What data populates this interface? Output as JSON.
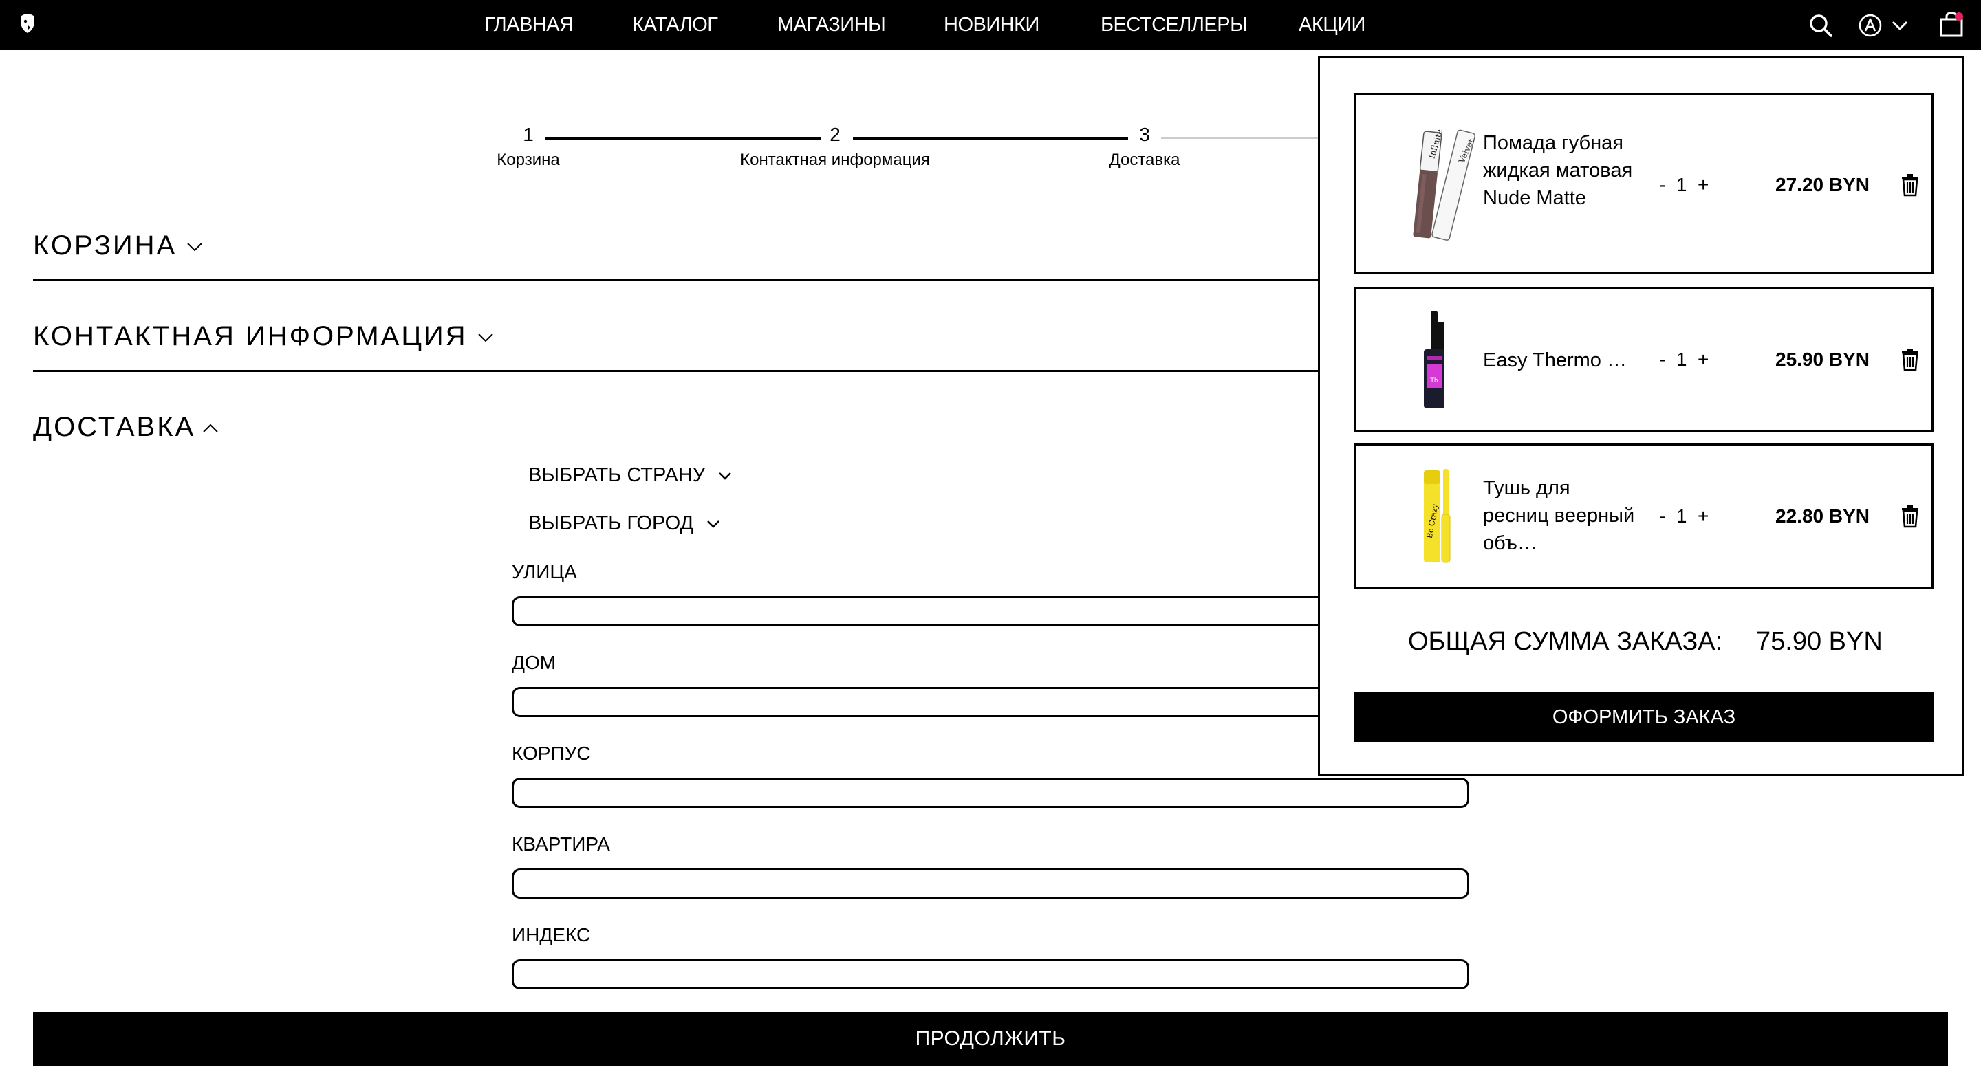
{
  "nav": {
    "items": [
      {
        "label": "ГЛАВНАЯ"
      },
      {
        "label": "КАТАЛОГ"
      },
      {
        "label": "МАГАЗИНЫ"
      },
      {
        "label": "НОВИНКИ"
      },
      {
        "label": "БЕСТСЕЛЛЕРЫ"
      },
      {
        "label": "АКЦИИ"
      }
    ],
    "icons": [
      "search-icon",
      "account-icon",
      "chevron-down-icon",
      "shopping-bag-icon"
    ]
  },
  "stepper": {
    "steps": [
      {
        "number": "1",
        "label": "Корзина"
      },
      {
        "number": "2",
        "label": "Контактная информация"
      },
      {
        "number": "3",
        "label": "Доставка"
      }
    ]
  },
  "sections": {
    "cart": "КОРЗИНА",
    "contact": "КОНТАКТНАЯ ИНФОРМАЦИЯ",
    "delivery": "ДОСТАВКА"
  },
  "delivery": {
    "country_select": "ВЫБРАТЬ СТРАНУ",
    "city_select": "ВЫБРАТЬ ГОРОД",
    "fields": [
      {
        "label": "УЛИЦА",
        "value": ""
      },
      {
        "label": "ДОМ",
        "value": ""
      },
      {
        "label": "КОРПУС",
        "value": ""
      },
      {
        "label": "КВАРТИРА",
        "value": ""
      },
      {
        "label": "ИНДЕКС",
        "value": ""
      }
    ],
    "continue_label": "ПРОДОЛЖИТЬ"
  },
  "cart_panel": {
    "items": [
      {
        "name": "Помада губная жидкая матовая Nude Matte",
        "quantity": "1",
        "minus": "-",
        "plus": "+",
        "price": "27.20 BYN"
      },
      {
        "name": "Easy Thermo …",
        "quantity": "1",
        "minus": "-",
        "plus": "+",
        "price": "25.90 BYN"
      },
      {
        "name": "Тушь для ресниц веерный объ…",
        "quantity": "1",
        "minus": "-",
        "plus": "+",
        "price": "22.80 BYN"
      }
    ],
    "total_label": "ОБЩАЯ СУММА ЗАКАЗА:",
    "total_value": "75.90 BYN",
    "checkout_label": "ОФОРМИТЬ ЗАКАЗ"
  },
  "colors": {
    "primary": "#000000",
    "background": "#ffffff",
    "inactive_line": "#cccccc",
    "lipstick": "#6b4e4e",
    "mascara_accent": "#d63ad6",
    "mascara_yellow": "#f5e12a"
  }
}
